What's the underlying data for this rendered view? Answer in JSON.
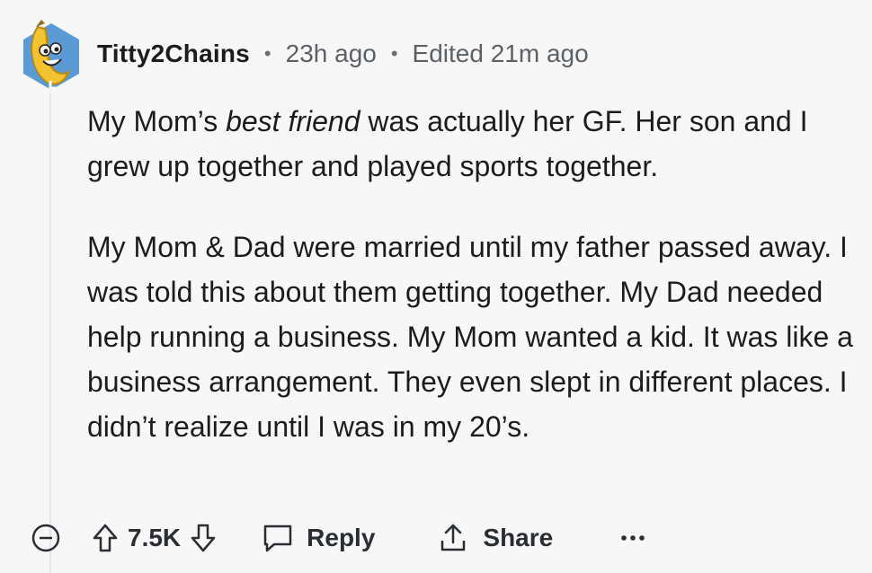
{
  "comment": {
    "username": "Titty2Chains",
    "time_ago": "23h ago",
    "edited": "Edited 21m ago",
    "paragraph1_before": "My Mom’s ",
    "paragraph1_italic": "best friend",
    "paragraph1_after": " was actually her GF. Her son and I grew up together and played sports together.",
    "paragraph2": "My Mom & Dad were married until my father passed away. I was told this about them getting together. My Dad needed help running a business. My Mom wanted a kid. It was like a business arrangement. They even slept in different places. I didn’t realize until I was in my 20’s."
  },
  "actions": {
    "score": "7.5K",
    "reply_label": "Reply",
    "share_label": "Share"
  },
  "icons": {
    "avatar": "banana-avatar-icon",
    "collapse": "collapse-minus-icon",
    "upvote": "upvote-arrow-icon",
    "downvote": "downvote-arrow-icon",
    "reply": "speech-bubble-icon",
    "share": "share-upload-icon",
    "more": "more-dots-icon"
  },
  "colors": {
    "background": "#f7f7f8",
    "text": "#1c1c1c",
    "meta": "#5c6166",
    "avatar_bg": "#5b9bd5",
    "banana": "#f2c230"
  }
}
